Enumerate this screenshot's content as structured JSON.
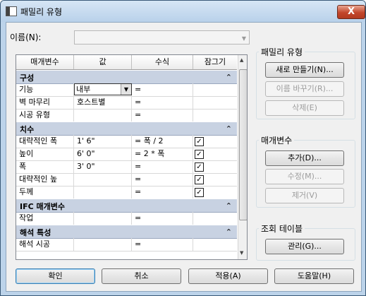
{
  "window": {
    "title": "패밀리 유형",
    "close_label": "X"
  },
  "name_field": {
    "label": "이름(N):",
    "value": ""
  },
  "grid": {
    "columns": [
      "매개변수",
      "값",
      "수식",
      "잠그기"
    ],
    "groups": [
      {
        "title": "구성",
        "rows": [
          {
            "name": "기능",
            "value": "내부",
            "formula": "=",
            "locked": null
          },
          {
            "name": "벽 마무리",
            "value": "호스트별",
            "formula": "=",
            "locked": null
          },
          {
            "name": "시공 유형",
            "value": "",
            "formula": "=",
            "locked": null
          }
        ]
      },
      {
        "title": "치수",
        "rows": [
          {
            "name": "대략적인 폭",
            "value": "1'  6\"",
            "formula": "= 폭 / 2",
            "locked": true
          },
          {
            "name": "높이",
            "value": "6'  0\"",
            "formula": "= 2 * 폭",
            "locked": true
          },
          {
            "name": "폭",
            "value": "3'  0\"",
            "formula": "=",
            "locked": true
          },
          {
            "name": "대략적인 높",
            "value": "",
            "formula": "=",
            "locked": true
          },
          {
            "name": "두께",
            "value": "",
            "formula": "=",
            "locked": true
          }
        ]
      },
      {
        "title": "IFC 매개변수",
        "rows": [
          {
            "name": "작업",
            "value": "",
            "formula": "=",
            "locked": null
          }
        ]
      },
      {
        "title": "해석 특성",
        "rows": [
          {
            "name": "해석 시공",
            "value": "",
            "formula": "=",
            "locked": null
          }
        ]
      }
    ],
    "collapse_icon": "double-chevron-up-icon"
  },
  "family_types_group": {
    "title": "패밀리 유형",
    "new_button": "새로 만들기(N)...",
    "rename_button": "이름 바꾸기(R)...",
    "delete_button": "삭제(E)"
  },
  "parameters_group": {
    "title": "매개변수",
    "add_button": "추가(D)...",
    "modify_button": "수정(M)...",
    "remove_button": "제거(V)"
  },
  "lookup_group": {
    "title": "조회 테이블",
    "manage_button": "관리(G)..."
  },
  "footer": {
    "ok": "확인",
    "cancel": "취소",
    "apply": "적용(A)",
    "help": "도움말(H)"
  }
}
